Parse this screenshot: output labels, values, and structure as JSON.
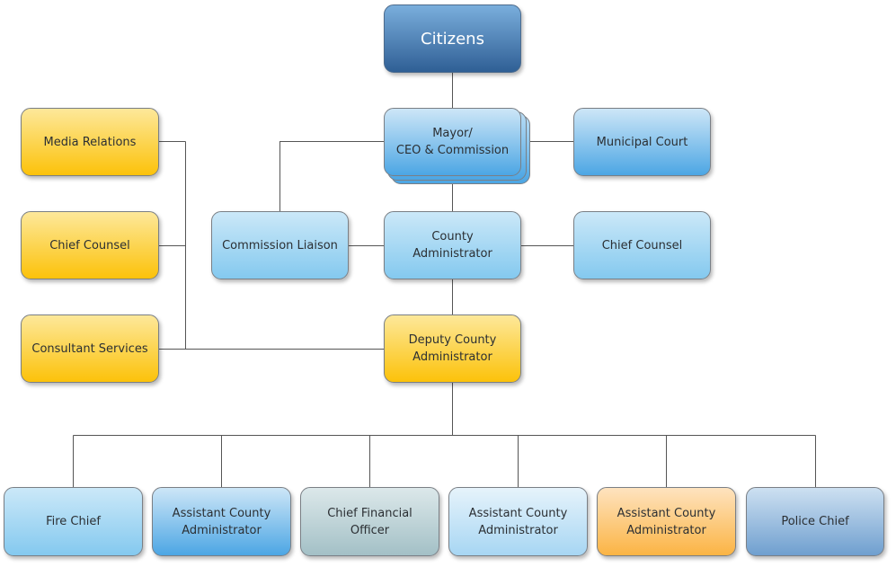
{
  "diagram": {
    "type": "organizational-chart",
    "nodes": {
      "citizens": "Citizens",
      "mayor": "Mayor/\nCEO & Commission",
      "municipal_court": "Municipal Court",
      "media_relations": "Media Relations",
      "chief_counsel_left": "Chief Counsel",
      "consultant_services": "Consultant Services",
      "commission_liaison": "Commission Liaison",
      "county_administrator": "County Administrator",
      "chief_counsel_right": "Chief Counsel",
      "deputy_county_administrator": "Deputy County\nAdministrator",
      "fire_chief": "Fire Chief",
      "assistant_county_administrator_1": "Assistant County\nAdministrator",
      "chief_financial_officer": "Chief Financial Officer",
      "assistant_county_administrator_2": "Assistant County\nAdministrator",
      "assistant_county_administrator_3": "Assistant County\nAdministrator",
      "police_chief": "Police Chief"
    },
    "edges": [
      [
        "citizens",
        "mayor"
      ],
      [
        "mayor",
        "municipal_court"
      ],
      [
        "mayor",
        "commission_liaison"
      ],
      [
        "mayor",
        "county_administrator"
      ],
      [
        "county_administrator",
        "commission_liaison"
      ],
      [
        "county_administrator",
        "chief_counsel_right"
      ],
      [
        "county_administrator",
        "deputy_county_administrator"
      ],
      [
        "deputy_county_administrator",
        "media_relations"
      ],
      [
        "deputy_county_administrator",
        "chief_counsel_left"
      ],
      [
        "deputy_county_administrator",
        "consultant_services"
      ],
      [
        "deputy_county_administrator",
        "fire_chief"
      ],
      [
        "deputy_county_administrator",
        "assistant_county_administrator_1"
      ],
      [
        "deputy_county_administrator",
        "chief_financial_officer"
      ],
      [
        "deputy_county_administrator",
        "assistant_county_administrator_2"
      ],
      [
        "deputy_county_administrator",
        "assistant_county_administrator_3"
      ],
      [
        "deputy_county_administrator",
        "police_chief"
      ]
    ],
    "colors": {
      "navy": "#2f5f95",
      "gold": "#fcc20a",
      "sky": "#84c9ef",
      "blue": "#4ca6e4",
      "teal": "#a3c0c6",
      "amber": "#fbb444",
      "steel": "#6f9fcf",
      "connector": "#555555"
    }
  }
}
